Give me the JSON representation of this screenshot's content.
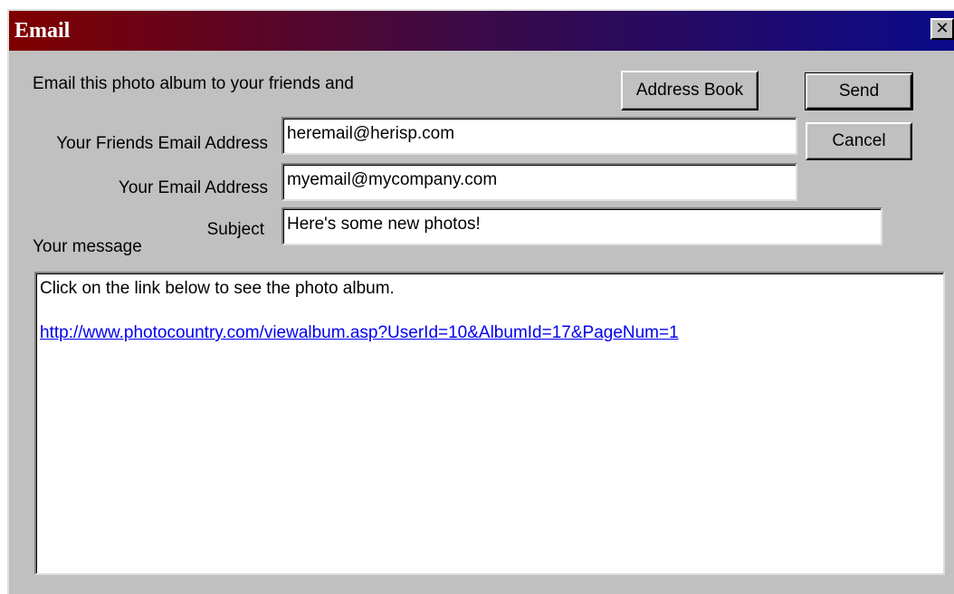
{
  "window": {
    "title": "Email",
    "close_glyph": "✕"
  },
  "intro_text": "Email this photo album to your friends and",
  "buttons": {
    "address_book": "Address Book",
    "send": "Send",
    "cancel": "Cancel"
  },
  "fields": {
    "friends_email": {
      "label": "Your Friends Email Address",
      "value": "heremail@herisp.com"
    },
    "your_email": {
      "label": "Your Email Address",
      "value": "myemail@mycompany.com"
    },
    "subject": {
      "label": "Subject",
      "value": "Here's some new photos!"
    }
  },
  "message": {
    "label": "Your message",
    "line1": "Click on the link below to see the photo album.",
    "link": "http://www.photocountry.com/viewalbum.asp?UserId=10&AlbumId=17&PageNum=1"
  }
}
